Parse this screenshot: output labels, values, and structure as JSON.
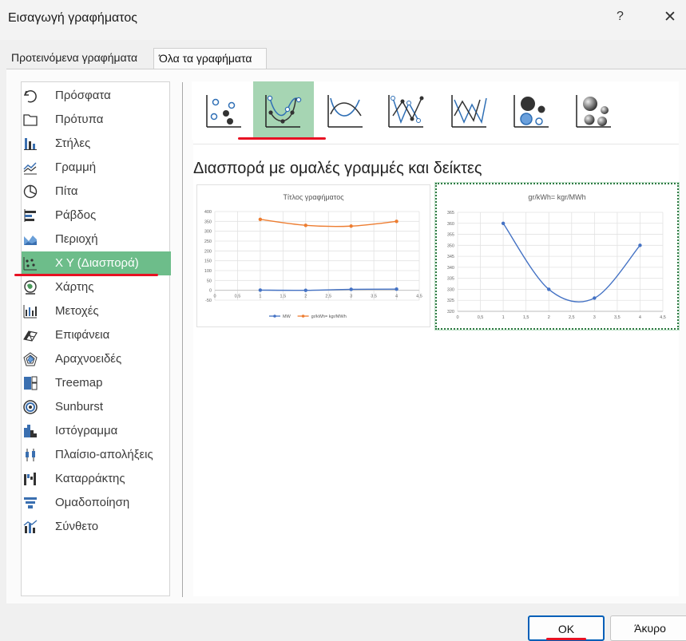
{
  "window": {
    "title": "Εισαγωγή γραφήματος",
    "help": "?",
    "close": "✕"
  },
  "tabs": [
    {
      "label": "Προτεινόμενα γραφήματα",
      "active": false
    },
    {
      "label": "Όλα τα γραφήματα",
      "active": true
    }
  ],
  "categories": [
    {
      "label": "Πρόσφατα",
      "icon": "recent-icon"
    },
    {
      "label": "Πρότυπα",
      "icon": "templates-folder-icon"
    },
    {
      "label": "Στήλες",
      "icon": "column-chart-icon"
    },
    {
      "label": "Γραμμή",
      "icon": "line-chart-icon"
    },
    {
      "label": "Πίτα",
      "icon": "pie-chart-icon"
    },
    {
      "label": "Ράβδος",
      "icon": "bar-chart-icon"
    },
    {
      "label": "Περιοχή",
      "icon": "area-chart-icon"
    },
    {
      "label": "X Y (Διασπορά)",
      "icon": "scatter-chart-icon",
      "selected": true
    },
    {
      "label": "Χάρτης",
      "icon": "map-chart-icon"
    },
    {
      "label": "Μετοχές",
      "icon": "stock-chart-icon"
    },
    {
      "label": "Επιφάνεια",
      "icon": "surface-chart-icon"
    },
    {
      "label": "Αραχνοειδές",
      "icon": "radar-chart-icon"
    },
    {
      "label": "Treemap",
      "icon": "treemap-icon"
    },
    {
      "label": "Sunburst",
      "icon": "sunburst-icon"
    },
    {
      "label": "Ιστόγραμμα",
      "icon": "histogram-icon"
    },
    {
      "label": "Πλαίσιο-απολήξεις",
      "icon": "box-whisker-icon"
    },
    {
      "label": "Καταρράκτης",
      "icon": "waterfall-icon"
    },
    {
      "label": "Ομαδοποίηση",
      "icon": "funnel-icon"
    },
    {
      "label": "Σύνθετο",
      "icon": "combo-chart-icon"
    }
  ],
  "subtypes": [
    {
      "icon": "scatter-markers-icon",
      "selected": false
    },
    {
      "icon": "scatter-smooth-lines-markers-icon",
      "selected": true
    },
    {
      "icon": "scatter-smooth-lines-icon",
      "selected": false
    },
    {
      "icon": "scatter-straight-lines-markers-icon",
      "selected": false
    },
    {
      "icon": "scatter-straight-lines-icon",
      "selected": false
    },
    {
      "icon": "bubble-icon",
      "selected": false
    },
    {
      "icon": "3d-bubble-icon",
      "selected": false
    }
  ],
  "chart_type_title": "Διασπορά με ομαλές γραμμές και δείκτες",
  "colors": {
    "selected_green": "#6dbd8a",
    "subtype_green": "#a6d5b3",
    "series_blue": "#4472c4",
    "series_orange": "#ed7d31",
    "annotation_red": "#e81123",
    "focus_blue": "#005fb8"
  },
  "chart_data": [
    {
      "type": "scatter",
      "title": "Τίτλος γραφήματος",
      "xlim": [
        0,
        4.5
      ],
      "ylim": [
        -50,
        400
      ],
      "xticks": [
        "0",
        "0,5",
        "1",
        "1,5",
        "2",
        "2,5",
        "3",
        "3,5",
        "4",
        "4,5"
      ],
      "yticks": [
        "-50",
        "0",
        "50",
        "100",
        "150",
        "200",
        "250",
        "300",
        "350",
        "400"
      ],
      "grid": true,
      "legend": "bottom",
      "series": [
        {
          "name": "MW",
          "color": "#4472c4",
          "x": [
            1,
            2,
            3,
            4
          ],
          "y": [
            1,
            0,
            5,
            6
          ]
        },
        {
          "name": "gr/kWh= kgr/MWh",
          "color": "#ed7d31",
          "x": [
            1,
            2,
            3,
            4
          ],
          "y": [
            360,
            330,
            326,
            350
          ]
        }
      ]
    },
    {
      "type": "scatter",
      "title": "gr/kWh= kgr/MWh",
      "xlim": [
        0,
        4.5
      ],
      "ylim": [
        320,
        365
      ],
      "xticks": [
        "0",
        "0,5",
        "1",
        "1,5",
        "2",
        "2,5",
        "3",
        "3,5",
        "4",
        "4,5"
      ],
      "yticks": [
        "320",
        "325",
        "330",
        "335",
        "340",
        "345",
        "350",
        "355",
        "360",
        "365"
      ],
      "grid": true,
      "legend": "none",
      "series": [
        {
          "color": "#4472c4",
          "x": [
            1,
            2,
            3,
            4
          ],
          "y": [
            360,
            330,
            326,
            350
          ]
        }
      ]
    }
  ],
  "buttons": {
    "ok": "OK",
    "cancel": "Άκυρο"
  }
}
